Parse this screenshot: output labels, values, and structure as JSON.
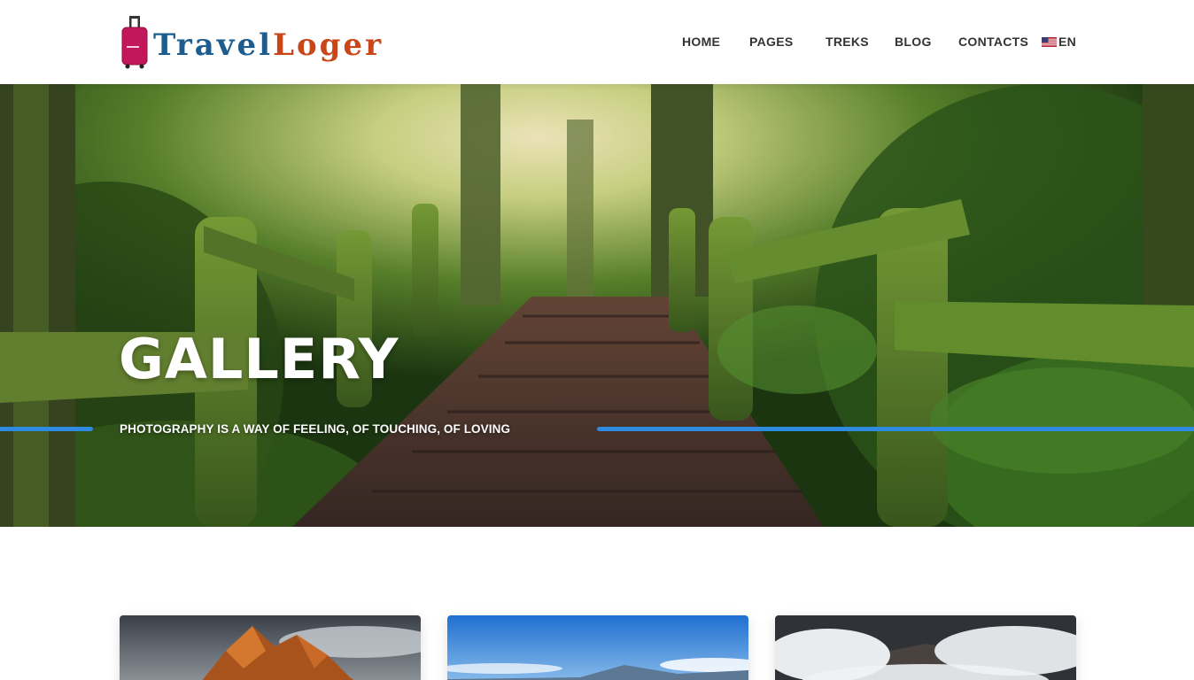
{
  "header": {
    "logo": {
      "part1": "Travel",
      "part2": "Loger"
    },
    "nav": [
      {
        "label": "HOME"
      },
      {
        "label": "PAGES"
      },
      {
        "label": "TREKS"
      },
      {
        "label": "BLOG"
      },
      {
        "label": "CONTACTS"
      }
    ],
    "language": {
      "label": "EN",
      "icon": "us-flag-icon"
    }
  },
  "hero": {
    "title": "GALLERY",
    "subtitle": "PHOTOGRAPHY IS A WAY OF FEELING, OF TOUCHING, OF LOVING",
    "accent_color": "#2f8be0"
  },
  "colors": {
    "logo_blue": "#1d5c8e",
    "logo_orange": "#c8461a",
    "nav_text": "#333333"
  }
}
